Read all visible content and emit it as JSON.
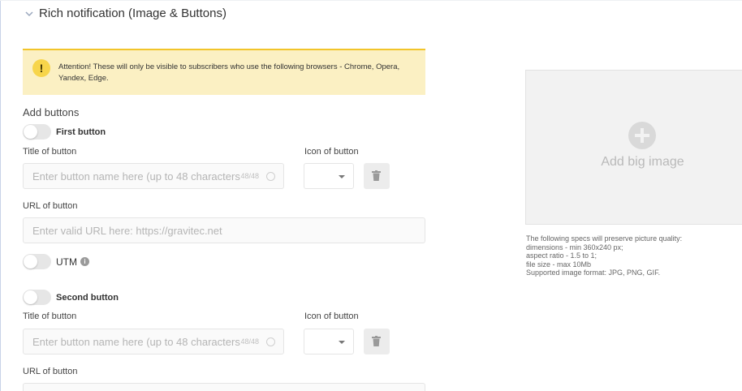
{
  "section": {
    "title": "Rich notification (Image & Buttons)"
  },
  "alert": {
    "icon": "!",
    "text": "Attention! These will only be visible to subscribers who use the following browsers - Chrome, Opera, Yandex, Edge."
  },
  "buttons_heading": "Add buttons",
  "first_button": {
    "toggle_label": "First button",
    "title_label": "Title of button",
    "title_placeholder": "Enter button name here (up to 48 characters",
    "counter": "48/48",
    "icon_label": "Icon of button",
    "url_label": "URL of button",
    "url_placeholder": "Enter valid URL here: https://gravitec.net",
    "utm_label": "UTM"
  },
  "second_button": {
    "toggle_label": "Second button",
    "title_label": "Title of button",
    "title_placeholder": "Enter button name here (up to 48 characters",
    "counter": "48/48",
    "icon_label": "Icon of button",
    "url_label": "URL of button"
  },
  "image": {
    "label": "Add big image",
    "specs": [
      "The following specs will preserve picture quality:",
      "dimensions - min 360x240 px;",
      "aspect ratio - 1.5 to 1;",
      "file size - max 10Mb",
      "Supported image format: JPG, PNG, GIF."
    ]
  },
  "colors": {
    "alert_bg": "#fbf0c3",
    "alert_border": "#f2c52b",
    "alert_icon": "#f7d54b"
  },
  "icons": [
    "chevron-down-icon",
    "warning-icon",
    "info-icon",
    "emoji-icon",
    "caret-down-icon",
    "trash-icon",
    "plus-circle-icon"
  ]
}
